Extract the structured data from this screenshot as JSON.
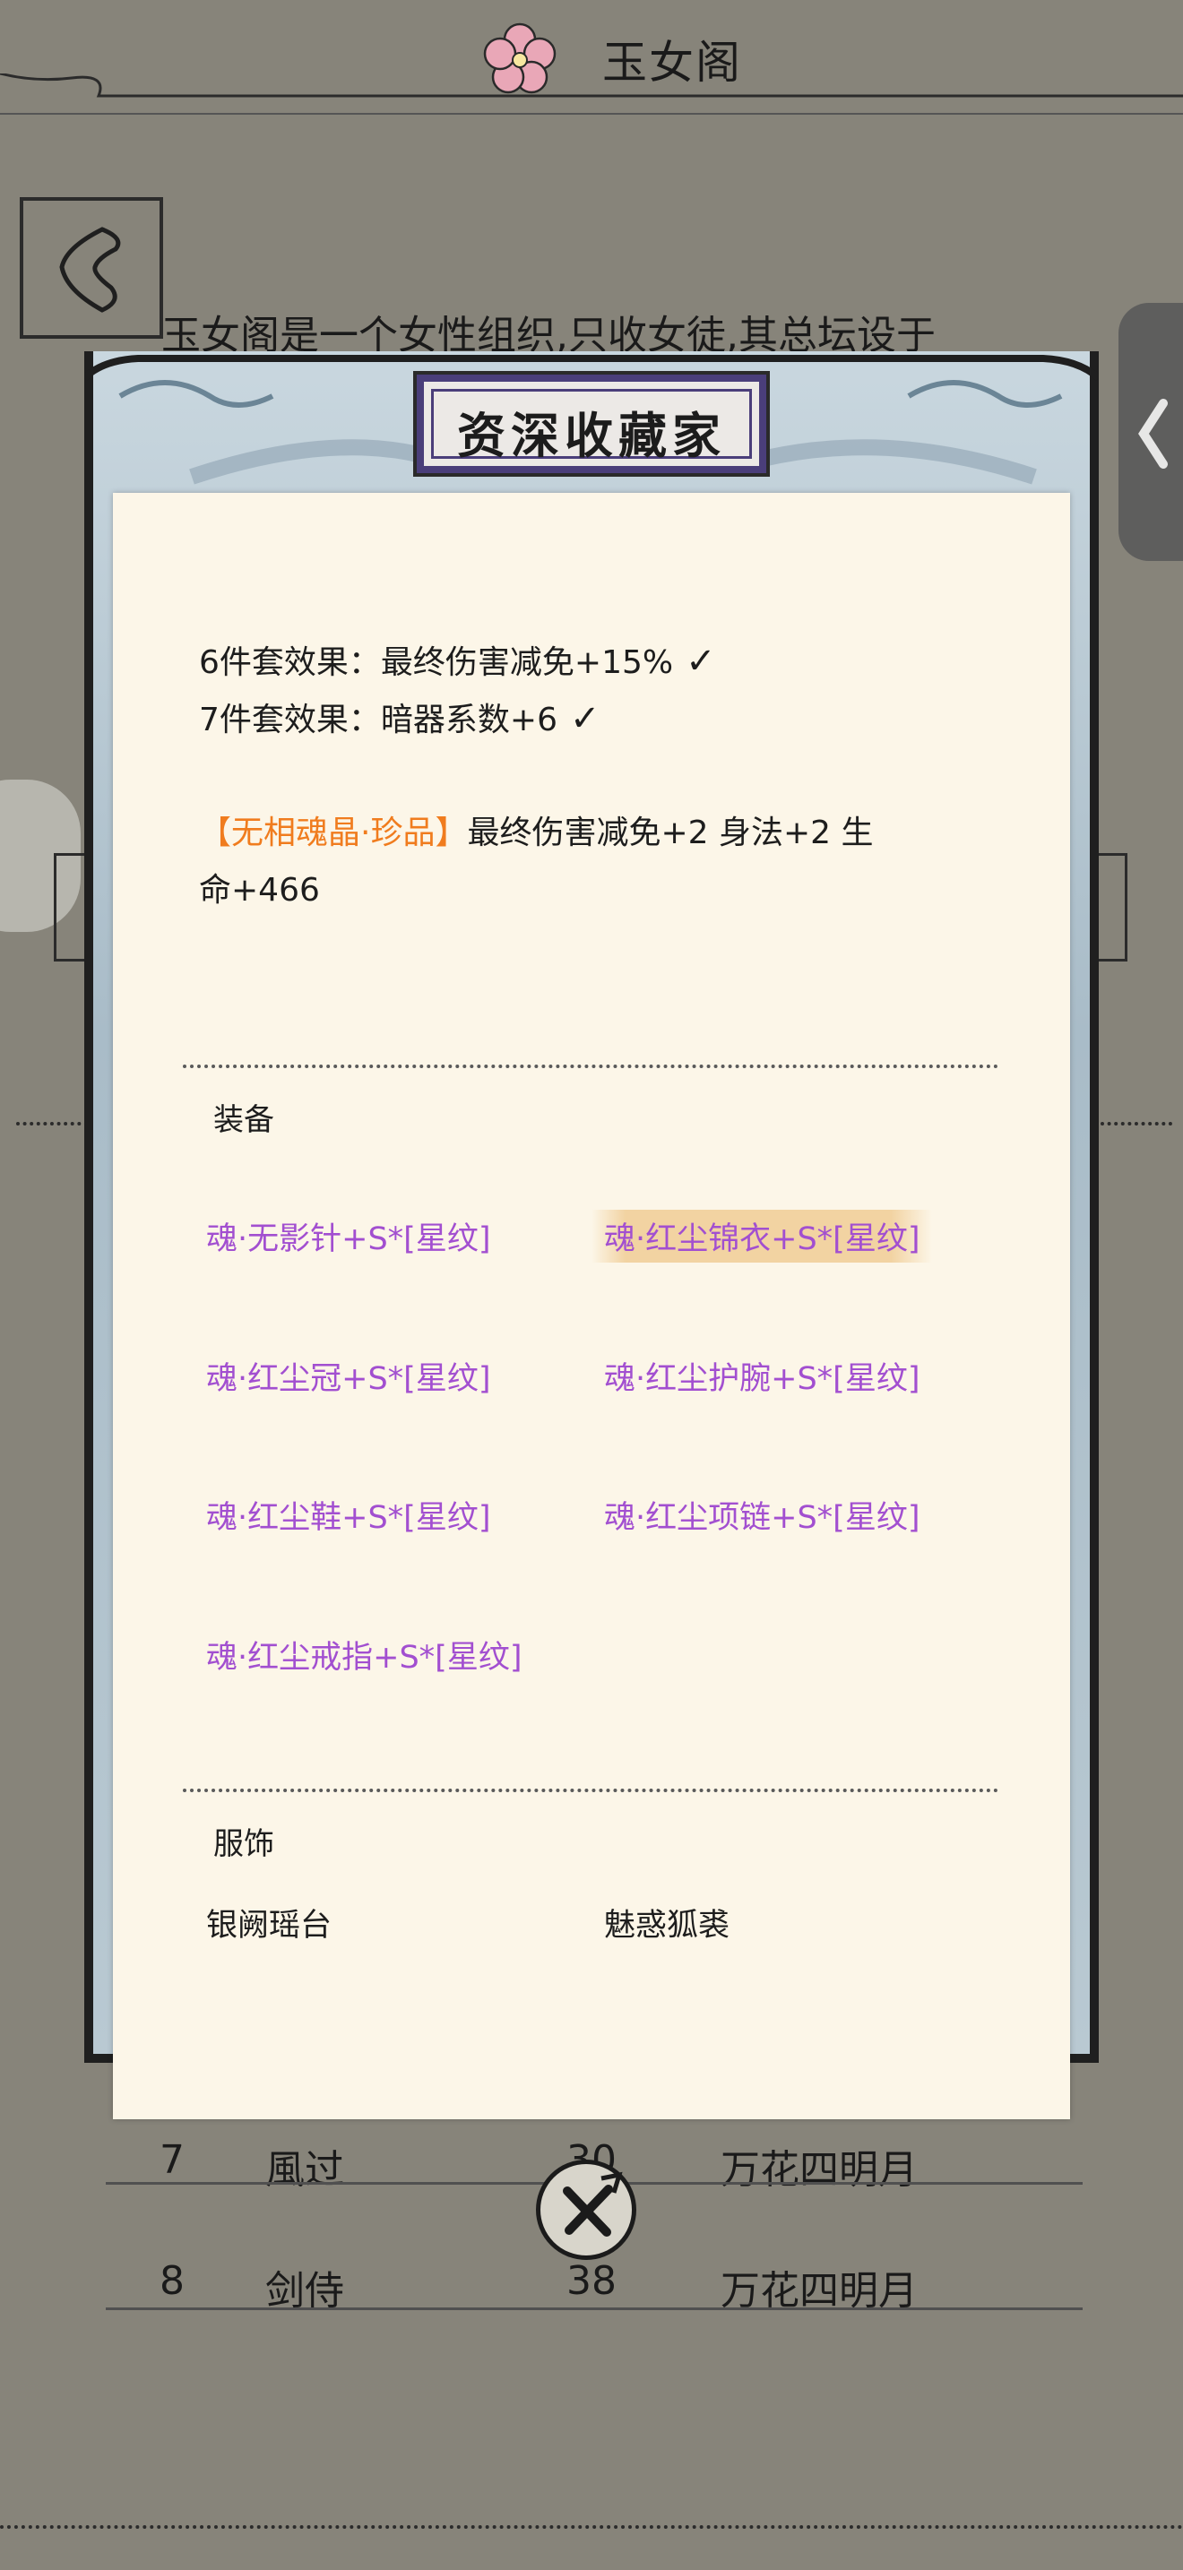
{
  "header": {
    "title": "玉女阁"
  },
  "background": {
    "intro": "玉女阁是一个女性组织,只收女徒,其总坛设于",
    "rows": [
      {
        "rank": "7",
        "name": "風过",
        "level": "30",
        "server": "万花四明月"
      },
      {
        "rank": "8",
        "name": "剑侍",
        "level": "38",
        "server": "万花四明月"
      }
    ]
  },
  "modal": {
    "title": "资深收藏家",
    "set_effects": [
      {
        "text": "6件套效果：最终伤害减免+15%",
        "check": "✓"
      },
      {
        "text": "7件套效果：暗器系数+6",
        "check": "✓"
      }
    ],
    "soul_crystal": {
      "name": "【无相魂晶·珍品】",
      "effect_line1": "最终伤害减免+2 身法+2 生",
      "effect_line2": "命+466"
    },
    "equipment": {
      "title": "装备",
      "items": [
        "魂·无影针+S*[星纹]",
        "魂·红尘锦衣+S*[星纹]",
        "魂·红尘冠+S*[星纹]",
        "魂·红尘护腕+S*[星纹]",
        "魂·红尘鞋+S*[星纹]",
        "魂·红尘项链+S*[星纹]",
        "魂·红尘戒指+S*[星纹]"
      ]
    },
    "costume": {
      "title": "服饰",
      "items": [
        "银阙瑶台",
        "魅惑狐裘"
      ]
    }
  },
  "colors": {
    "equip_purple": "#a24fd0",
    "crystal_orange": "#f07c1e",
    "paper": "#fcf6e8"
  }
}
